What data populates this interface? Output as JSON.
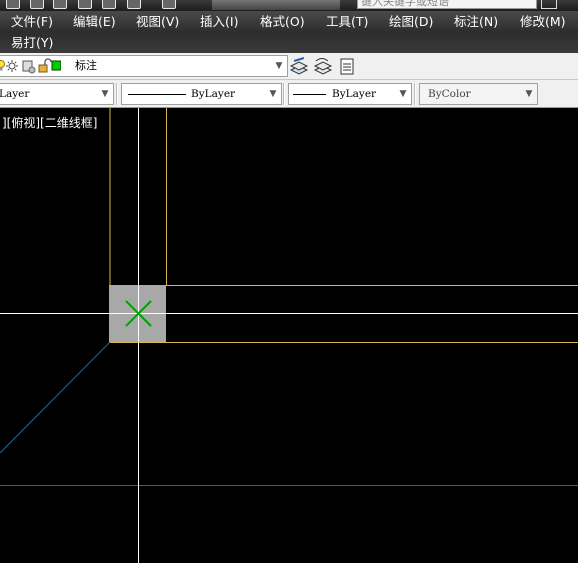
{
  "search": {
    "placeholder": "键入关键字或短语"
  },
  "menu": {
    "items": [
      {
        "label": "文件(F)"
      },
      {
        "label": "编辑(E)"
      },
      {
        "label": "视图(V)"
      },
      {
        "label": "插入(I)"
      },
      {
        "label": "格式(O)"
      },
      {
        "label": "工具(T)"
      },
      {
        "label": "绘图(D)"
      },
      {
        "label": "标注(N)"
      },
      {
        "label": "修改(M)"
      },
      {
        "label": "易打(Y)"
      }
    ]
  },
  "layer": {
    "current": "标注",
    "swatch_color": "#00cc00"
  },
  "properties": {
    "color": "Layer",
    "linetype": "ByLayer",
    "lineweight": "ByLayer",
    "plotstyle": "ByColor"
  },
  "viewport": {
    "label": "][俯视][二维线框]"
  },
  "colors": {
    "crosshair": "#ffffff",
    "construction": "#d9b84a",
    "snap_box": "#a8a8a8",
    "snap_marker": "#00a000",
    "aux_line": "#1f6a9a"
  }
}
